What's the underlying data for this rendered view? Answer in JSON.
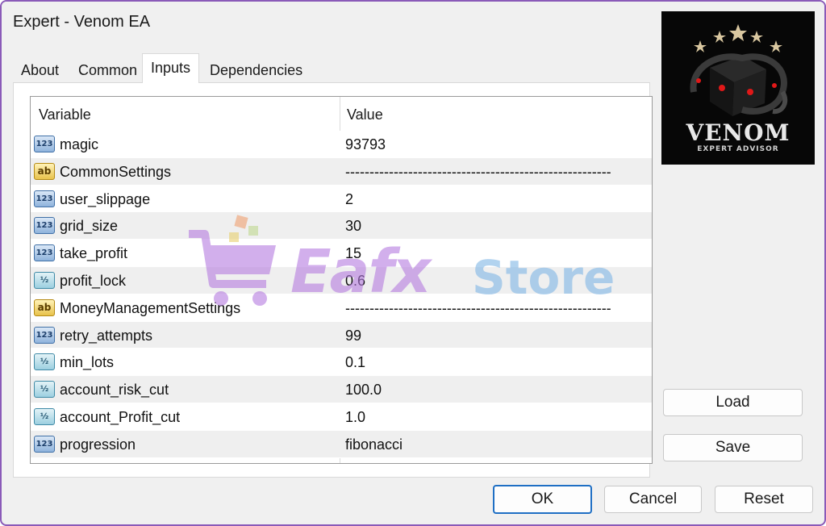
{
  "window": {
    "title": "Expert - Venom EA"
  },
  "tabs": [
    {
      "label": "About"
    },
    {
      "label": "Common"
    },
    {
      "label": "Inputs"
    },
    {
      "label": "Dependencies"
    }
  ],
  "active_tab": "Inputs",
  "grid": {
    "headers": {
      "variable": "Variable",
      "value": "Value"
    },
    "rows": [
      {
        "icon": "int-icon",
        "icon_text": "123",
        "variable": "magic",
        "value": "93793"
      },
      {
        "icon": "string-icon",
        "icon_text": "ab",
        "variable": "CommonSettings",
        "value": "-------------------------------------------------------"
      },
      {
        "icon": "int-icon",
        "icon_text": "123",
        "variable": "user_slippage",
        "value": "2"
      },
      {
        "icon": "int-icon",
        "icon_text": "123",
        "variable": "grid_size",
        "value": "30"
      },
      {
        "icon": "int-icon",
        "icon_text": "123",
        "variable": "take_profit",
        "value": "15"
      },
      {
        "icon": "double-icon",
        "icon_text": "½",
        "variable": "profit_lock",
        "value": "0.6"
      },
      {
        "icon": "string-icon",
        "icon_text": "ab",
        "variable": "MoneyManagementSettings",
        "value": "-------------------------------------------------------"
      },
      {
        "icon": "int-icon",
        "icon_text": "123",
        "variable": "retry_attempts",
        "value": "99"
      },
      {
        "icon": "double-icon",
        "icon_text": "½",
        "variable": "min_lots",
        "value": "0.1"
      },
      {
        "icon": "double-icon",
        "icon_text": "½",
        "variable": "account_risk_cut",
        "value": "100.0"
      },
      {
        "icon": "double-icon",
        "icon_text": "½",
        "variable": "account_Profit_cut",
        "value": "1.0"
      },
      {
        "icon": "int-icon",
        "icon_text": "123",
        "variable": "progression",
        "value": "fibonacci"
      }
    ]
  },
  "buttons": {
    "load": "Load",
    "save": "Save",
    "ok": "OK",
    "cancel": "Cancel",
    "reset": "Reset"
  },
  "logo": {
    "name": "VENOM",
    "subtitle": "EXPERT ADVISOR"
  },
  "watermark": {
    "brand": "Eafx",
    "suffix": "Store"
  },
  "colors": {
    "accent": "#1f6fc4",
    "window_border": "#8a5ab8",
    "watermark_purple": "#b57be0",
    "watermark_blue": "#7fb6e6"
  }
}
